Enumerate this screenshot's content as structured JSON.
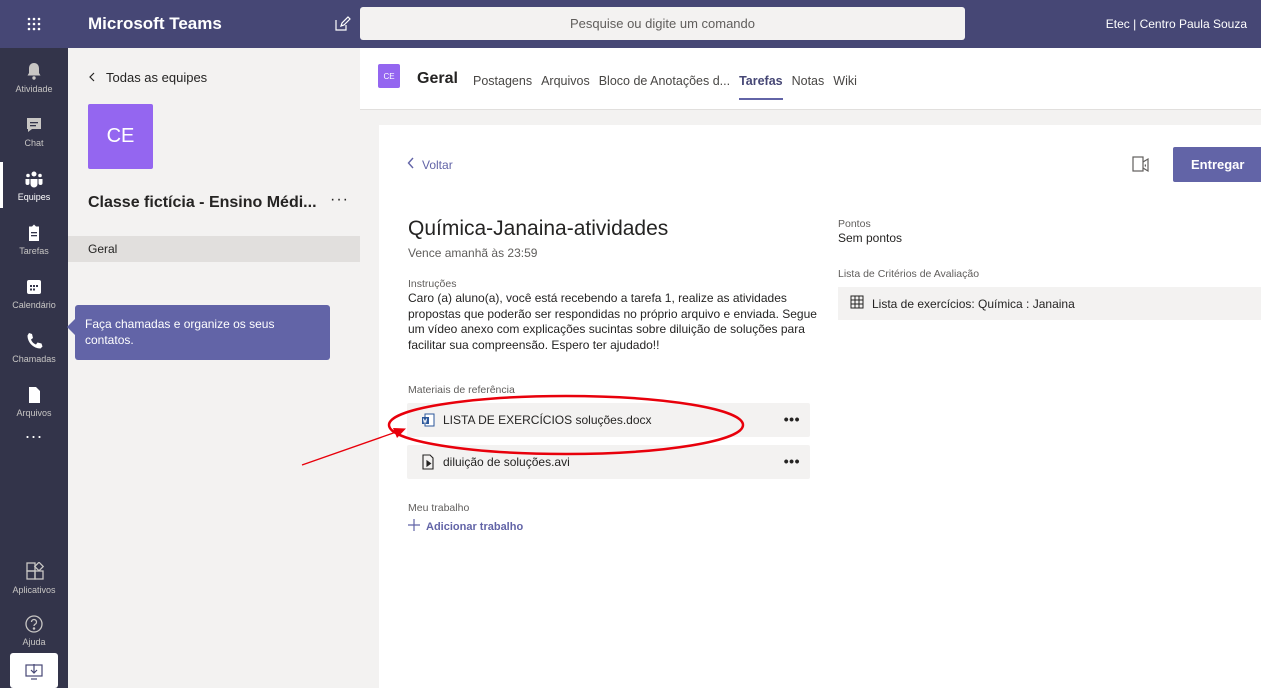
{
  "topbar": {
    "app_title": "Microsoft Teams",
    "search_placeholder": "Pesquise ou digite um comando",
    "org_name": "Etec | Centro Paula Souza"
  },
  "rail": {
    "items": [
      {
        "label": "Atividade",
        "icon": "bell-icon"
      },
      {
        "label": "Chat",
        "icon": "chat-icon"
      },
      {
        "label": "Equipes",
        "icon": "teams-icon"
      },
      {
        "label": "Tarefas",
        "icon": "assignments-icon"
      },
      {
        "label": "Calendário",
        "icon": "calendar-icon"
      },
      {
        "label": "Chamadas",
        "icon": "phone-icon"
      },
      {
        "label": "Arquivos",
        "icon": "files-icon"
      },
      {
        "label": "Aplicativos",
        "icon": "apps-icon"
      },
      {
        "label": "Ajuda",
        "icon": "help-icon"
      }
    ],
    "more_label": "...",
    "active": "Equipes"
  },
  "panel": {
    "back_label": "Todas as equipes",
    "team_initials": "CE",
    "team_name": "Classe fictícia - Ensino Médi...",
    "team_more": "···",
    "channel": "Geral"
  },
  "tooltip": {
    "text": "Faça chamadas e organize os seus contatos."
  },
  "channel_header": {
    "avatar": "CE",
    "name": "Geral",
    "tabs": [
      "Postagens",
      "Arquivos",
      "Bloco de Anotações d...",
      "Tarefas",
      "Notas",
      "Wiki"
    ],
    "active_tab": "Tarefas"
  },
  "assignment": {
    "back_label": "Voltar",
    "submit_label": "Entregar",
    "title": "Química-Janaina-atividades",
    "due": "Vence amanhã às 23:59",
    "instructions_label": "Instruções",
    "instructions": "Caro (a) aluno(a), você está recebendo a tarefa 1, realize as atividades propostas que poderão ser respondidas no próprio arquivo e enviada. Segue um vídeo anexo com explicações sucintas sobre diluição de soluções para facilitar sua compreensão. Espero ter ajudado!!",
    "materials_label": "Materiais de referência",
    "files": [
      {
        "name": "LISTA DE EXERCÍCIOS soluções.docx",
        "icon": "word-doc-icon",
        "more": "•••"
      },
      {
        "name": "diluição de soluções.avi",
        "icon": "video-file-icon",
        "more": "•••"
      }
    ],
    "my_work_label": "Meu trabalho",
    "add_work_label": "Adicionar trabalho",
    "points_label": "Pontos",
    "points_value": "Sem pontos",
    "rubric_label": "Lista de Critérios de Avaliação",
    "rubric_item": "Lista de exercícios: Química : Janaina"
  },
  "colors": {
    "topbar": "#464775",
    "rail": "#33344a",
    "accent": "#6264a7",
    "team_avatar": "#9466f0",
    "annotation": "#e8000b"
  }
}
